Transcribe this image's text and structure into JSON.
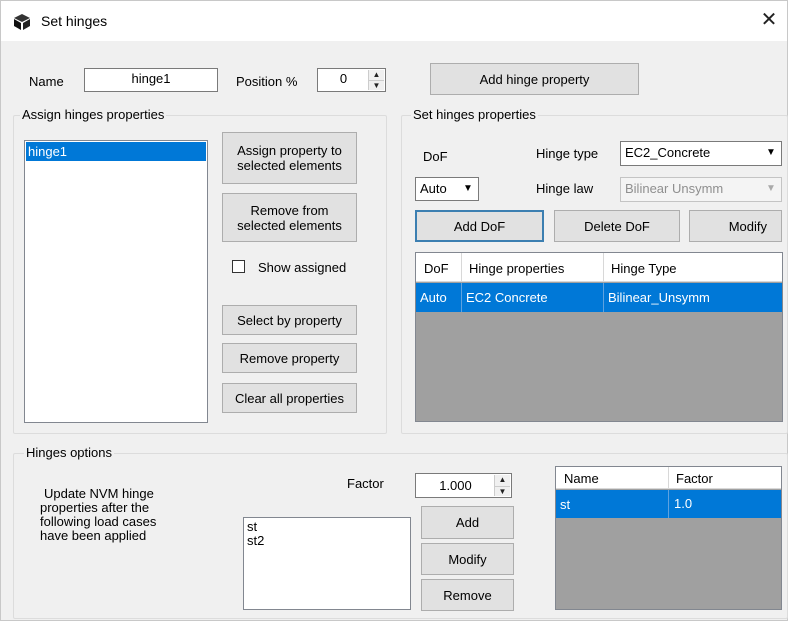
{
  "window": {
    "title": "Set hinges"
  },
  "top": {
    "name_label": "Name",
    "name_value": "hinge1",
    "position_label": "Position %",
    "position_value": "0",
    "add_hinge_property": "Add hinge property"
  },
  "assign": {
    "title": "Assign hinges properties",
    "list_items": [
      "hinge1"
    ],
    "assign_btn_line1": "Assign property to",
    "assign_btn_line2": "selected elements",
    "remove_btn_line1": "Remove from",
    "remove_btn_line2": "selected elements",
    "show_assigned": "Show assigned",
    "select_by_property": "Select by property",
    "remove_property": "Remove property",
    "clear_all": "Clear all properties"
  },
  "set": {
    "title": "Set hinges properties",
    "dof_label": "DoF",
    "dof_value": "Auto",
    "hinge_type_label": "Hinge type",
    "hinge_type_value": "EC2_Concrete",
    "hinge_law_label": "Hinge law",
    "hinge_law_value": "Bilinear Unsymm",
    "add_dof": "Add DoF",
    "delete_dof": "Delete DoF",
    "modify": "Modify",
    "table": {
      "headers": [
        "DoF",
        "Hinge properties",
        "Hinge Type"
      ],
      "rows": [
        [
          "Auto",
          "EC2 Concrete",
          "Bilinear_Unsymm"
        ]
      ]
    }
  },
  "options": {
    "title": "Hinges options",
    "description": "Update NVM hinge properties after the following load cases have been applied",
    "desc_lines": [
      "Update NVM hinge",
      "properties after the",
      "following load cases",
      "have been applied"
    ],
    "factor_label": "Factor",
    "factor_value": "1.000",
    "load_cases": [
      "st",
      "st2"
    ],
    "add": "Add",
    "modify": "Modify",
    "remove": "Remove",
    "table": {
      "headers": [
        "Name",
        "Factor"
      ],
      "rows": [
        [
          "st",
          "1.0"
        ]
      ]
    }
  },
  "colors": {
    "selection": "#0078d7",
    "grid_bg": "#a0a0a0",
    "window_bg": "#f0f0f0"
  },
  "icons": {
    "app": "cube-icon",
    "close": "close-icon"
  }
}
